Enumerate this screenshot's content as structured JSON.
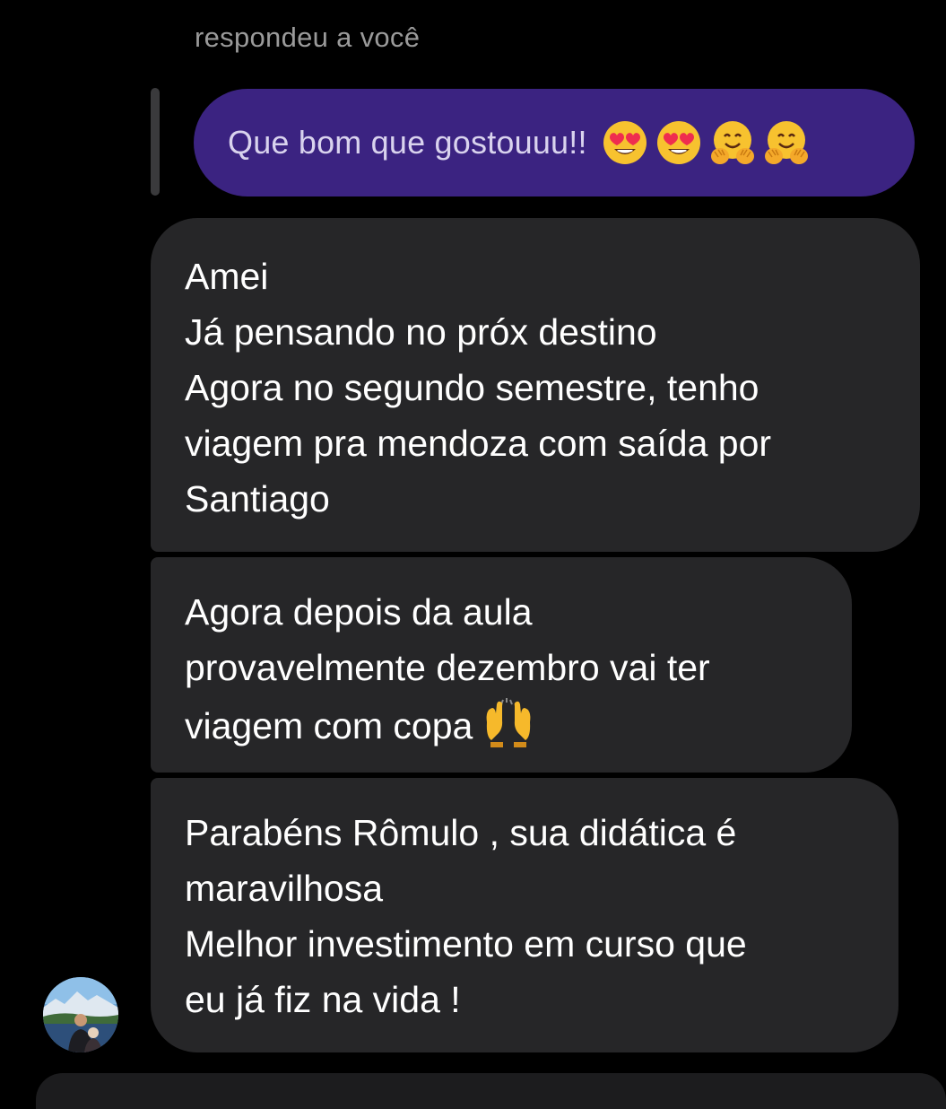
{
  "reply": {
    "caption": "respondeu a você",
    "quoted_text": "Que bom que gostouuu!!",
    "quoted_emojis": [
      "heart-eyes-emoji",
      "heart-eyes-emoji",
      "hugging-face-emoji",
      "hugging-face-emoji"
    ]
  },
  "messages": [
    {
      "lines": [
        "Amei",
        "Já pensando no próx destino",
        "Agora no segundo semestre, tenho",
        "viagem pra mendoza com saída por",
        "Santiago"
      ]
    },
    {
      "lines": [
        "Agora depois da aula",
        "provavelmente dezembro vai ter",
        "viagem com copa"
      ],
      "trailing_emoji": "raising-hands-emoji"
    },
    {
      "lines": [
        "Parabéns Rômulo , sua didática é",
        "maravilhosa",
        "Melhor investimento em curso que",
        "eu já fiz na vida !"
      ]
    }
  ],
  "colors": {
    "background": "#000000",
    "quoted_bubble": "#3b2381",
    "incoming_bubble": "#262628",
    "caption_text": "#9a9a9a"
  },
  "avatar": {
    "icon": "sender-avatar"
  }
}
